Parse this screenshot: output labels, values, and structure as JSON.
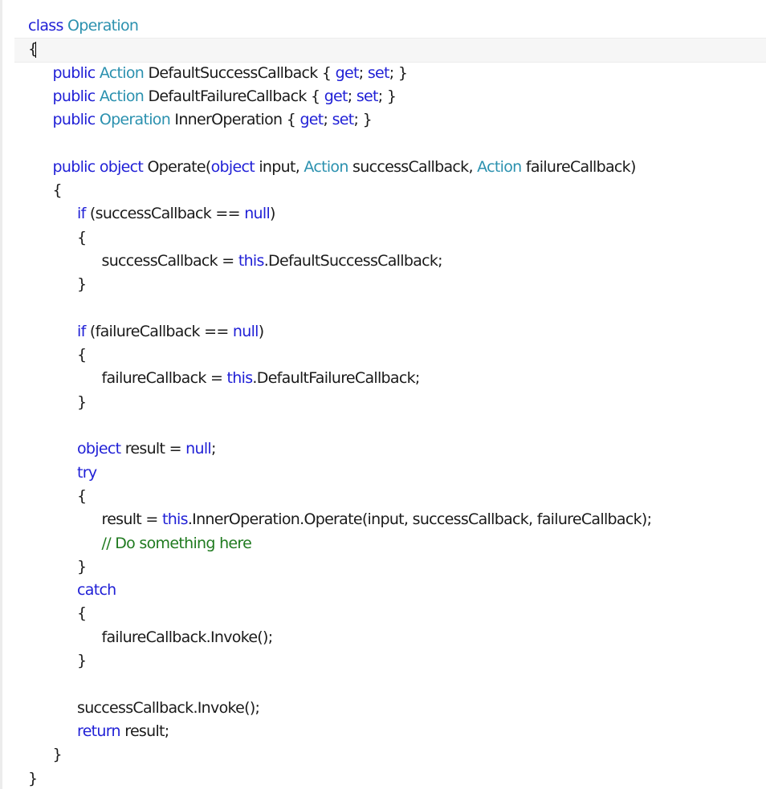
{
  "editor": {
    "colors": {
      "keyword": "#1f1fd6",
      "type": "#2b91af",
      "comment": "#1f7a1f",
      "text": "#1a1a1a",
      "current_line": "#f6f6f6"
    },
    "lines": [
      {
        "indent": 0,
        "parts": [
          {
            "t": "class",
            "c": "kw"
          },
          {
            "t": " "
          },
          {
            "t": "Operation",
            "c": "type"
          }
        ]
      },
      {
        "indent": 0,
        "parts": [
          {
            "t": "{"
          }
        ],
        "caret": true
      },
      {
        "indent": 1,
        "parts": [
          {
            "t": "public",
            "c": "kw"
          },
          {
            "t": " "
          },
          {
            "t": "Action",
            "c": "type"
          },
          {
            "t": " DefaultSuccessCallback { "
          },
          {
            "t": "get",
            "c": "kw"
          },
          {
            "t": "; "
          },
          {
            "t": "set",
            "c": "kw"
          },
          {
            "t": "; }"
          }
        ]
      },
      {
        "indent": 1,
        "parts": [
          {
            "t": "public",
            "c": "kw"
          },
          {
            "t": " "
          },
          {
            "t": "Action",
            "c": "type"
          },
          {
            "t": " DefaultFailureCallback { "
          },
          {
            "t": "get",
            "c": "kw"
          },
          {
            "t": "; "
          },
          {
            "t": "set",
            "c": "kw"
          },
          {
            "t": "; }"
          }
        ]
      },
      {
        "indent": 1,
        "parts": [
          {
            "t": "public",
            "c": "kw"
          },
          {
            "t": " "
          },
          {
            "t": "Operation",
            "c": "type"
          },
          {
            "t": " InnerOperation { "
          },
          {
            "t": "get",
            "c": "kw"
          },
          {
            "t": "; "
          },
          {
            "t": "set",
            "c": "kw"
          },
          {
            "t": "; }"
          }
        ]
      },
      {
        "indent": 0,
        "parts": []
      },
      {
        "indent": 1,
        "parts": [
          {
            "t": "public",
            "c": "kw"
          },
          {
            "t": " "
          },
          {
            "t": "object",
            "c": "kw"
          },
          {
            "t": " Operate("
          },
          {
            "t": "object",
            "c": "kw"
          },
          {
            "t": " input, "
          },
          {
            "t": "Action",
            "c": "type"
          },
          {
            "t": " successCallback, "
          },
          {
            "t": "Action",
            "c": "type"
          },
          {
            "t": " failureCallback)"
          }
        ]
      },
      {
        "indent": 1,
        "parts": [
          {
            "t": "{"
          }
        ]
      },
      {
        "indent": 2,
        "parts": [
          {
            "t": "if",
            "c": "kw"
          },
          {
            "t": " (successCallback == "
          },
          {
            "t": "null",
            "c": "kw"
          },
          {
            "t": ")"
          }
        ]
      },
      {
        "indent": 2,
        "parts": [
          {
            "t": "{"
          }
        ]
      },
      {
        "indent": 3,
        "parts": [
          {
            "t": "successCallback = "
          },
          {
            "t": "this",
            "c": "kw"
          },
          {
            "t": ".DefaultSuccessCallback;"
          }
        ]
      },
      {
        "indent": 2,
        "parts": [
          {
            "t": "}"
          }
        ]
      },
      {
        "indent": 0,
        "parts": []
      },
      {
        "indent": 2,
        "parts": [
          {
            "t": "if",
            "c": "kw"
          },
          {
            "t": " (failureCallback == "
          },
          {
            "t": "null",
            "c": "kw"
          },
          {
            "t": ")"
          }
        ]
      },
      {
        "indent": 2,
        "parts": [
          {
            "t": "{"
          }
        ]
      },
      {
        "indent": 3,
        "parts": [
          {
            "t": "failureCallback = "
          },
          {
            "t": "this",
            "c": "kw"
          },
          {
            "t": ".DefaultFailureCallback;"
          }
        ]
      },
      {
        "indent": 2,
        "parts": [
          {
            "t": "}"
          }
        ]
      },
      {
        "indent": 0,
        "parts": []
      },
      {
        "indent": 2,
        "parts": [
          {
            "t": "object",
            "c": "kw"
          },
          {
            "t": " result = "
          },
          {
            "t": "null",
            "c": "kw"
          },
          {
            "t": ";"
          }
        ]
      },
      {
        "indent": 2,
        "parts": [
          {
            "t": "try",
            "c": "kw"
          }
        ]
      },
      {
        "indent": 2,
        "parts": [
          {
            "t": "{"
          }
        ]
      },
      {
        "indent": 3,
        "parts": [
          {
            "t": "result = "
          },
          {
            "t": "this",
            "c": "kw"
          },
          {
            "t": ".InnerOperation.Operate(input, successCallback, failureCallback);"
          }
        ]
      },
      {
        "indent": 3,
        "parts": [
          {
            "t": "// Do something here",
            "c": "cm"
          }
        ]
      },
      {
        "indent": 2,
        "parts": [
          {
            "t": "}"
          }
        ]
      },
      {
        "indent": 2,
        "parts": [
          {
            "t": "catch",
            "c": "kw"
          }
        ]
      },
      {
        "indent": 2,
        "parts": [
          {
            "t": "{"
          }
        ]
      },
      {
        "indent": 3,
        "parts": [
          {
            "t": "failureCallback.Invoke();"
          }
        ]
      },
      {
        "indent": 2,
        "parts": [
          {
            "t": "}"
          }
        ]
      },
      {
        "indent": 0,
        "parts": []
      },
      {
        "indent": 2,
        "parts": [
          {
            "t": "successCallback.Invoke();"
          }
        ]
      },
      {
        "indent": 2,
        "parts": [
          {
            "t": "return",
            "c": "kw"
          },
          {
            "t": " result;"
          }
        ]
      },
      {
        "indent": 1,
        "parts": [
          {
            "t": "}"
          }
        ]
      },
      {
        "indent": 0,
        "parts": [
          {
            "t": "}"
          }
        ]
      }
    ]
  }
}
